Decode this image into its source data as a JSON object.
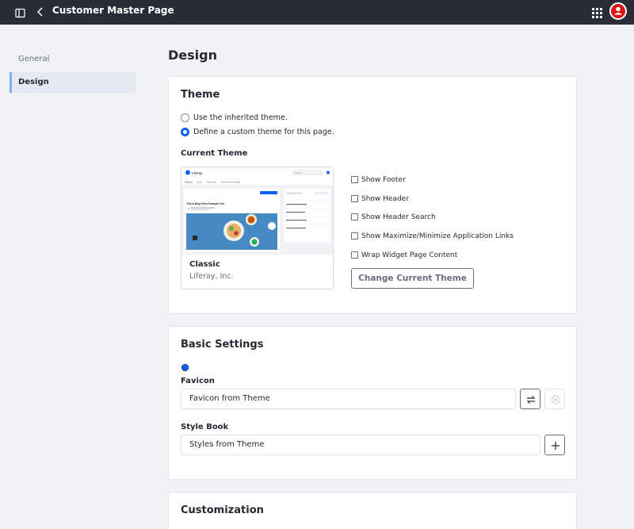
{
  "topbar": {
    "title": "Customer Master Page",
    "icons": [
      "sidebar-panel-icon",
      "back-arrow-icon",
      "apps-grid-icon",
      "user-avatar-icon"
    ],
    "avatar_color": "#da1414"
  },
  "sidebar": {
    "items": [
      {
        "label": "General",
        "active": false
      },
      {
        "label": "Design",
        "active": true
      }
    ]
  },
  "page": {
    "heading": "Design"
  },
  "theme_section": {
    "title": "Theme",
    "radios": [
      {
        "label": "Use the inherited theme.",
        "checked": false
      },
      {
        "label": "Define a custom theme for this page.",
        "checked": true
      }
    ],
    "current_theme_label": "Current Theme",
    "theme_card": {
      "name": "Classic",
      "author": "Liferay, Inc.",
      "preview": {
        "brand": "Liferay",
        "search": "Search",
        "nav": [
          "Welcome",
          "Blogs",
          "Documents",
          "Documents and Media"
        ],
        "post_title": "This is Blog Entry Example One",
        "aside_title": "Latest Blog Entries"
      }
    },
    "checkboxes": [
      {
        "label": "Show Footer",
        "checked": false
      },
      {
        "label": "Show Header",
        "checked": false
      },
      {
        "label": "Show Header Search",
        "checked": false
      },
      {
        "label": "Show Maximize/Minimize Application Links",
        "checked": false
      },
      {
        "label": "Wrap Widget Page Content",
        "checked": false
      }
    ],
    "change_button": "Change Current Theme"
  },
  "basic_settings": {
    "title": "Basic Settings",
    "favicon_label": "Favicon",
    "favicon_value": "Favicon from Theme",
    "stylebook_label": "Style Book",
    "stylebook_value": "Styles from Theme"
  },
  "customization": {
    "title": "Customization"
  },
  "colors": {
    "accent": "#0b5fff",
    "topbar_bg": "#282d38",
    "page_bg": "#f1f2f5",
    "sidebar_active_bg": "#e5e9f2",
    "sidebar_active_border": "#80acff"
  }
}
